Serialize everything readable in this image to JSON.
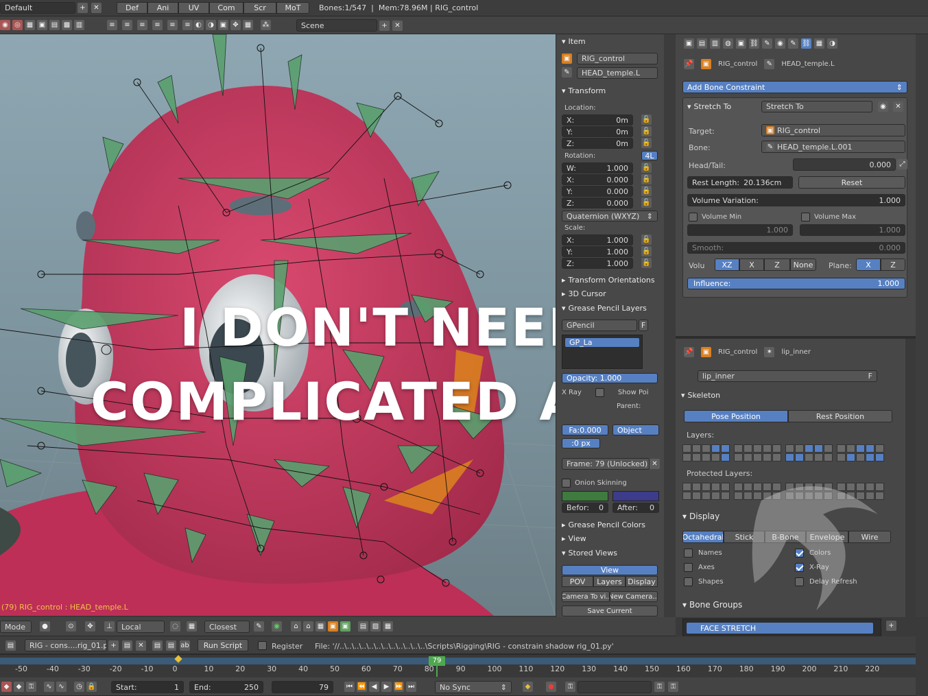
{
  "top_bar": {
    "layout_name": "Default",
    "tabs": [
      "Def",
      "Ani",
      "UV",
      "Com",
      "Scr",
      "MoT"
    ],
    "status": "Bones:1/547  |  Mem:78.96M | RIG_control"
  },
  "second_bar": {
    "scene": "Scene"
  },
  "viewport": {
    "object_label": "(79) RIG_control : HEAD_temple.L",
    "overlay_line1": "I DON'T NEED TO BE",
    "overlay_line2": "COMPLICATED AFTER ALL",
    "header": {
      "mode": "Mode",
      "orientation": "Local",
      "snap": "Closest"
    }
  },
  "n_panel": {
    "item_header": "Item",
    "object_name": "RIG_control",
    "bone_name": "HEAD_temple.L",
    "transform_header": "Transform",
    "location_label": "Location:",
    "location": [
      {
        "axis": "X:",
        "value": "0m"
      },
      {
        "axis": "Y:",
        "value": "0m"
      },
      {
        "axis": "Z:",
        "value": "0m"
      }
    ],
    "rotation_label": "Rotation:",
    "rotation_mode_badge": "4L",
    "rotation": [
      {
        "axis": "W:",
        "value": "1.000"
      },
      {
        "axis": "X:",
        "value": "0.000"
      },
      {
        "axis": "Y:",
        "value": "0.000"
      },
      {
        "axis": "Z:",
        "value": "0.000"
      }
    ],
    "rotation_mode": "Quaternion (WXYZ)",
    "scale_label": "Scale:",
    "scale": [
      {
        "axis": "X:",
        "value": "1.000"
      },
      {
        "axis": "Y:",
        "value": "1.000"
      },
      {
        "axis": "Z:",
        "value": "1.000"
      }
    ],
    "transform_orientations": "Transform Orientations",
    "cursor_3d": "3D Cursor",
    "grease_pencil_layers": "Grease Pencil Layers",
    "gpencil_name": "GPencil",
    "gpencil_f": "F",
    "gp_layer": "GP_La",
    "opacity_label": "Opacity: 1.000",
    "xray": "X Ray",
    "show_points": "Show Poi",
    "parent_label": "Parent:",
    "fa_value": "Fa:0.000",
    "object_type": "Object",
    "px_value": ":0 px",
    "frame_info": "Frame: 79 (Unlocked)",
    "onion_skinning": "Onion Skinning",
    "before": "Befor:",
    "before_value": "0",
    "after": "After:",
    "after_value": "0",
    "grease_pencil_colors": "Grease Pencil Colors",
    "view": "View",
    "stored_views": "Stored Views",
    "view_tab": "View",
    "pov_tab": "POV",
    "layers_tab": "Layers",
    "display_tab": "Display",
    "camera_to_view": "Camera To vi..",
    "new_camera": "New Camera...",
    "save_current": "Save Current"
  },
  "properties": {
    "breadcrumb_object": "RIG_control",
    "breadcrumb_bone": "HEAD_temple.L",
    "add_constraint": "Add Bone Constraint",
    "constraint_type": "Stretch To",
    "constraint_name": "Stretch To",
    "target_label": "Target:",
    "target_value": "RIG_control",
    "bone_label": "Bone:",
    "bone_value": "HEAD_temple.L.001",
    "headtail_label": "Head/Tail:",
    "headtail_value": "0.000",
    "rest_length_label": "Rest Length:",
    "rest_length_value": "20.136cm",
    "reset": "Reset",
    "volume_variation_label": "Volume Variation:",
    "volume_variation_value": "1.000",
    "volume_min": "Volume Min",
    "volume_max": "Volume Max",
    "volume_min_value": "1.000",
    "volume_max_value": "1.000",
    "smooth_label": "Smooth:",
    "smooth_value": "0.000",
    "volu_label": "Volu",
    "volu_options": [
      "XZ",
      "X",
      "Z",
      "None"
    ],
    "plane_label": "Plane:",
    "plane_options": [
      "X",
      "Z"
    ],
    "influence_label": "Influence:",
    "influence_value": "1.000"
  },
  "bone_properties": {
    "breadcrumb_object": "RIG_control",
    "breadcrumb_bone": "lip_inner",
    "bone_name": "lip_inner",
    "bone_f": "F",
    "skeleton": "Skeleton",
    "pose_position": "Pose Position",
    "rest_position": "Rest Position",
    "layers_label": "Layers:",
    "protected_layers_label": "Protected Layers:",
    "display_header": "Display",
    "display_types": [
      "Octahedral",
      "Stick",
      "B-Bone",
      "Envelope",
      "Wire"
    ],
    "names": "Names",
    "colors": "Colors",
    "axes": "Axes",
    "xray": "X-Ray",
    "shapes": "Shapes",
    "delay_refresh": "Delay Refresh",
    "bone_groups": "Bone Groups",
    "group_name": "FACE STRETCH"
  },
  "text_editor_bar": {
    "filename": "RIG - cons....rig_01.py",
    "run_script": "Run Script",
    "register": "Register",
    "file_path": "File: '//..\\..\\..\\..\\..\\..\\..\\..\\..\\..\\..\\..\\Scripts\\Rigging\\RIG - constrain shadow rig_01.py'"
  },
  "timeline": {
    "current_frame": "79",
    "ticks": [
      "-50",
      "-40",
      "-30",
      "-20",
      "-10",
      "0",
      "10",
      "20",
      "30",
      "40",
      "50",
      "60",
      "70",
      "80",
      "90",
      "100",
      "110",
      "120",
      "130",
      "140",
      "150",
      "160",
      "170",
      "180",
      "190",
      "200",
      "210",
      "220"
    ],
    "start_label": "Start:",
    "start_value": "1",
    "end_label": "End:",
    "end_value": "250",
    "frame_value": "79",
    "sync": "No Sync"
  },
  "colors": {
    "accent": "#5680c2",
    "mesh": "#c8365f",
    "bone": "#5aa06e"
  }
}
